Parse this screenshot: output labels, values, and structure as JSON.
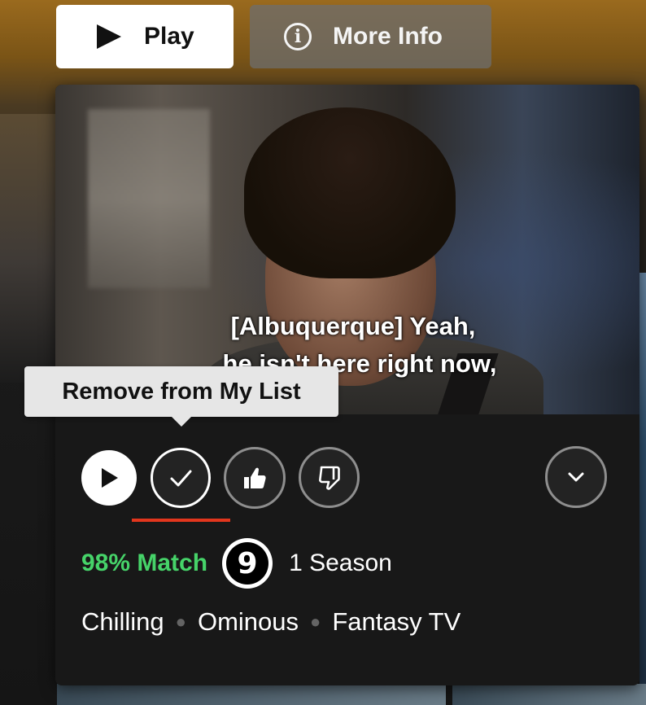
{
  "hero": {
    "play_label": "Play",
    "info_label": "More Info",
    "info_icon_glyph": "i"
  },
  "preview": {
    "subtitle_line1": "[Albuquerque] Yeah,",
    "subtitle_line2": "he isn't here right now,"
  },
  "tooltip": {
    "text": "Remove from My List"
  },
  "actions": {
    "play": "play-icon",
    "in_list": "check-icon",
    "like": "thumbs-up-icon",
    "dislike": "thumbs-down-icon",
    "more": "chevron-down-icon"
  },
  "meta": {
    "match": "98% Match",
    "maturity_rating": "9",
    "seasons": "1 Season"
  },
  "tags": [
    "Chilling",
    "Ominous",
    "Fantasy TV"
  ],
  "colors": {
    "match_green": "#46d369",
    "focus_red": "#e2361d",
    "card_bg": "#181818"
  }
}
